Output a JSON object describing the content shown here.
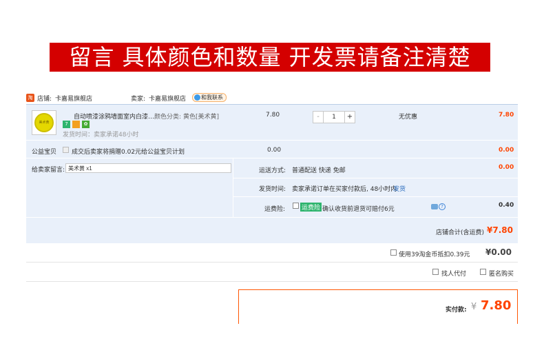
{
  "banner": {
    "text": "留言 具体颜色和数量 开发票请备注清楚"
  },
  "shop": {
    "icon": "淘",
    "store_label": "店铺:",
    "store_name": "卡嘉易旗舰店",
    "seller_label": "卖家:",
    "seller_name": "卡嘉易旗舰店",
    "contact_label": "和我联系"
  },
  "item": {
    "title": "自动喷漆涂鸦墙面室内白漆…",
    "thumb_text": "美术黄",
    "spec_label": "颜色分类:",
    "spec_value": "黄色[美术黄]",
    "badges": [
      "7",
      "",
      "✿"
    ],
    "shipping_time": "发货时间：卖家承诺48小时",
    "price": "7.80",
    "quantity": "1",
    "minus": "-",
    "plus": "+",
    "discount": "无优惠",
    "subtotal": "7.80"
  },
  "charity": {
    "label": "公益宝贝",
    "text": "成交后卖家将捐赠0.02元给公益宝贝计划",
    "price": "0.00",
    "total": "0.00"
  },
  "message": {
    "label": "给卖家留言:",
    "value": "美术黄 x1"
  },
  "delivery": {
    "label": "运送方式:",
    "value": "普通配送 快递 免邮",
    "price": "0.00"
  },
  "ship_time": {
    "label": "发货时间:",
    "value": "卖家承诺订单在买家付款后, 48小时内",
    "link": "发货"
  },
  "insurance": {
    "label": "运费险:",
    "tag": "运费险",
    "text": "确认收货前退货可赔付6元",
    "price": "0.40"
  },
  "store_total": {
    "label": "店铺合计(含运费)",
    "value": "¥7.80"
  },
  "coins": {
    "text": "使用39淘金币抵扣0.39元",
    "value": "¥0.00"
  },
  "options": {
    "proxy_pay": "找人代付",
    "anonymous": "匿名购买"
  },
  "payment": {
    "label": "实付款:",
    "currency": "¥",
    "value": "7.80"
  },
  "colors": {
    "accent": "#ff4400",
    "banner_bg": "#d40000",
    "panel_bg": "#e9f0fa",
    "tag_green": "#2db46d"
  }
}
